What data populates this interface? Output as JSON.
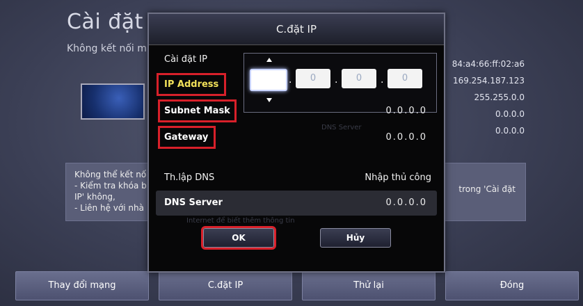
{
  "background": {
    "title": "Cài đặt m",
    "subtitle": "Không kết nối m",
    "values": [
      "84:a4:66:ff:02:a6",
      "169.254.187.123",
      "255.255.0.0",
      "0.0.0.0",
      "0.0.0.0"
    ],
    "error_text": "Không thể kết nố\n- Kiểm tra khóa b\nIP' không,\n- Liên hệ với nhà",
    "error_right": "trong 'Cài đặt",
    "buttons": [
      "Thay đổi mạng",
      "C.đặt IP",
      "Thử lại",
      "Đóng"
    ]
  },
  "dialog": {
    "title": "C.đặt IP",
    "ip_setting_label": "Cài đặt IP",
    "ip_octets": [
      "",
      "0",
      "0",
      "0"
    ],
    "fields": {
      "ip_address": {
        "label": "IP Address"
      },
      "subnet_mask": {
        "label": "Subnet Mask",
        "value": "0.0.0.0"
      },
      "gateway": {
        "label": "Gateway",
        "value": "0.0.0.0"
      }
    },
    "dns_setting": {
      "label": "Th.lập DNS",
      "value": "Nhập thủ công"
    },
    "dns_server": {
      "label": "DNS Server",
      "value": "0.0.0.0"
    },
    "faint_text": {
      "dns": "DNS Server",
      "info": "Internet để biết thêm thông tin"
    },
    "ok_label": "OK",
    "cancel_label": "Hủy"
  },
  "colors": {
    "highlight": "#d8202a",
    "active_label": "#f3e25a"
  }
}
